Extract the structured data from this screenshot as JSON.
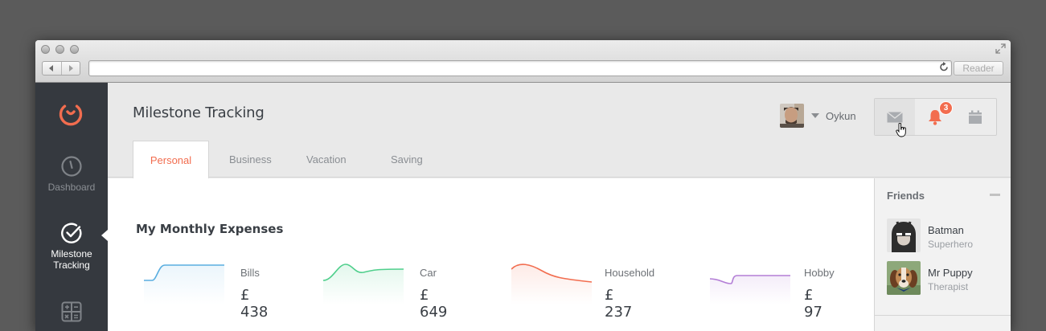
{
  "browser": {
    "reader_label": "Reader",
    "address": ""
  },
  "sidebar": {
    "items": [
      {
        "label": "Dashboard",
        "icon": "speedometer-icon"
      },
      {
        "label": "Milestone Tracking",
        "icon": "check-circle-icon",
        "active": true
      },
      {
        "label": "",
        "icon": "calculator-icon"
      }
    ]
  },
  "header": {
    "title": "Milestone Tracking",
    "user": {
      "name": "Oykun"
    },
    "notifications_count": "3",
    "tabs": [
      {
        "label": "Personal",
        "active": true
      },
      {
        "label": "Business"
      },
      {
        "label": "Vacation"
      },
      {
        "label": "Saving"
      }
    ]
  },
  "main": {
    "section_title": "My Monthly Expenses",
    "expenses": [
      {
        "label": "Bills",
        "value": "£ 438",
        "color": "#5aaee0"
      },
      {
        "label": "Car",
        "value": "£ 649",
        "color": "#4fcf8c"
      },
      {
        "label": "Household",
        "value": "£ 237",
        "color": "#f26d4f"
      },
      {
        "label": "Hobby",
        "value": "£ 97",
        "color": "#b37ed6"
      }
    ]
  },
  "friends": {
    "title": "Friends",
    "list": [
      {
        "name": "Batman",
        "role": "Superhero"
      },
      {
        "name": "Mr Puppy",
        "role": "Therapist"
      }
    ]
  },
  "colors": {
    "accent": "#f26d4f",
    "sidebar_bg": "#35393f"
  }
}
